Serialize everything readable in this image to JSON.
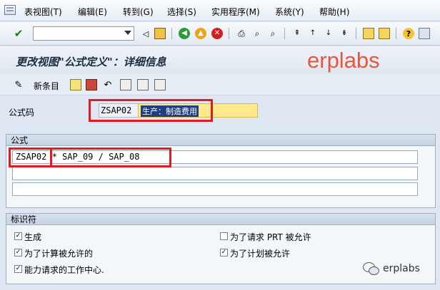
{
  "menu": {
    "items": [
      "表视图(T)",
      "编辑(E)",
      "转到(G)",
      "选择(S)",
      "实用程序(M)",
      "系统(Y)",
      "帮助(H)"
    ]
  },
  "toolbar": {
    "command_value": "",
    "icons": [
      "ok-check-icon",
      "back-triangle-icon",
      "save-icon",
      "back-icon",
      "exit-icon",
      "cancel-icon",
      "print-icon",
      "find-icon",
      "find-next-icon",
      "first-page-icon",
      "prev-page-icon",
      "next-page-icon",
      "last-page-icon",
      "new-session-icon",
      "shortcut-icon",
      "help-icon",
      "layout-icon"
    ]
  },
  "title": {
    "text": "更改视图\"公式定义\"：详细信息",
    "watermark": "erplabs"
  },
  "app_toolbar": {
    "new_entries": "新条目"
  },
  "header_fields": {
    "formula_code_label": "公式码",
    "formula_code_value": "ZSAP02",
    "formula_desc_value": "生产：制造费用"
  },
  "formula_group": {
    "title": "公式",
    "line1_code": "ZSAP02",
    "line1_rest": "* SAP_09 / SAP_08",
    "line2": "",
    "line3": ""
  },
  "indicator_group": {
    "title": "标识符",
    "checkboxes": [
      {
        "label": "生成",
        "checked": true
      },
      {
        "label": "为了计算被允许的",
        "checked": true
      },
      {
        "label": "能力请求的工作中心.",
        "checked": true
      },
      {
        "label": "为了请求  PRT  被允许",
        "checked": false
      },
      {
        "label": "为了计划被允许",
        "checked": true
      }
    ]
  },
  "footer_watermark": "erplabs",
  "colors": {
    "highlight_red": "#e01b24",
    "watermark_orange": "#e8563e",
    "required_field_yellow": "#ffe98a"
  }
}
